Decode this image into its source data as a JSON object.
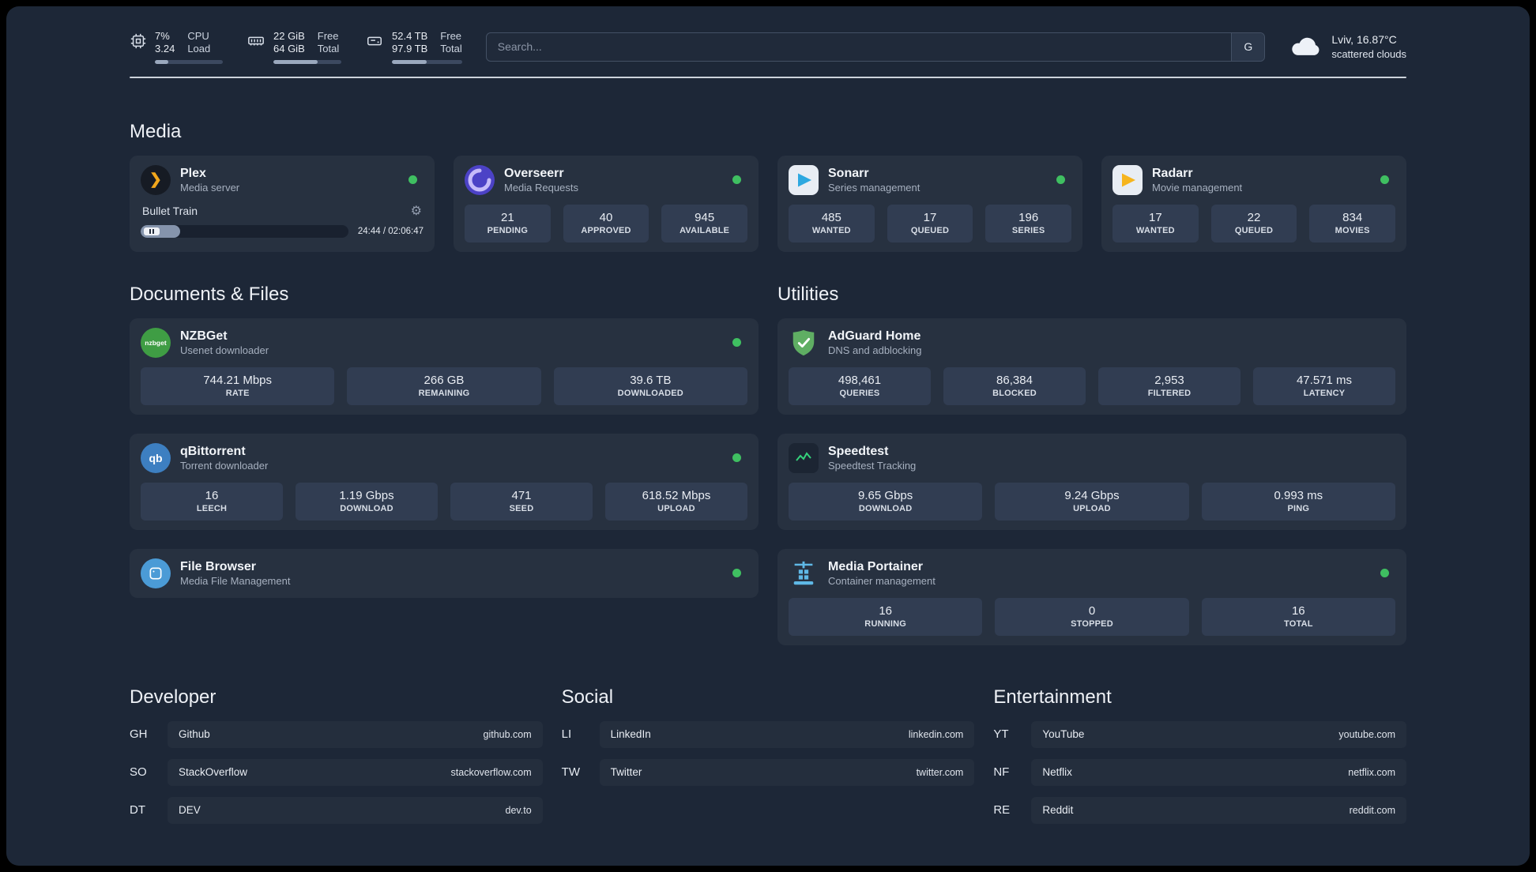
{
  "colors": {
    "status_online": "#3fbf61",
    "page_bg": "#1d2737",
    "card_bg": "#273140",
    "tile_bg": "#313d52"
  },
  "icons": {
    "plex_glyph": "❯",
    "gear_glyph": "⚙",
    "qbittorrent_glyph": "qb",
    "nzbget_glyph": "nzbget"
  },
  "topbar": {
    "cpu": {
      "percent": "7%",
      "load": "3.24",
      "label1": "CPU",
      "label2": "Load",
      "bar": 20
    },
    "memory": {
      "value1": "22 GiB",
      "value2": "64 GiB",
      "label1": "Free",
      "label2": "Total",
      "bar": 65
    },
    "disk": {
      "value1": "52.4 TB",
      "value2": "97.9 TB",
      "label1": "Free",
      "label2": "Total",
      "bar": 50
    },
    "search": {
      "placeholder": "Search...",
      "button": "G"
    },
    "weather": {
      "location": "Lviv, 16.87°C",
      "condition": "scattered clouds"
    }
  },
  "sections": {
    "media": {
      "title": "Media",
      "plex": {
        "name": "Plex",
        "subtitle": "Media server",
        "now_playing": "Bullet Train",
        "time": "24:44 / 02:06:47",
        "progress": 19
      },
      "overseerr": {
        "name": "Overseerr",
        "subtitle": "Media Requests",
        "stats": [
          {
            "value": "21",
            "label": "PENDING"
          },
          {
            "value": "40",
            "label": "APPROVED"
          },
          {
            "value": "945",
            "label": "AVAILABLE"
          }
        ]
      },
      "sonarr": {
        "name": "Sonarr",
        "subtitle": "Series management",
        "stats": [
          {
            "value": "485",
            "label": "WANTED"
          },
          {
            "value": "17",
            "label": "QUEUED"
          },
          {
            "value": "196",
            "label": "SERIES"
          }
        ]
      },
      "radarr": {
        "name": "Radarr",
        "subtitle": "Movie management",
        "stats": [
          {
            "value": "17",
            "label": "WANTED"
          },
          {
            "value": "22",
            "label": "QUEUED"
          },
          {
            "value": "834",
            "label": "MOVIES"
          }
        ]
      }
    },
    "documents": {
      "title": "Documents & Files",
      "nzbget": {
        "name": "NZBGet",
        "subtitle": "Usenet downloader",
        "stats": [
          {
            "value": "744.21 Mbps",
            "label": "RATE"
          },
          {
            "value": "266 GB",
            "label": "REMAINING"
          },
          {
            "value": "39.6 TB",
            "label": "DOWNLOADED"
          }
        ]
      },
      "qbittorrent": {
        "name": "qBittorrent",
        "subtitle": "Torrent downloader",
        "stats": [
          {
            "value": "16",
            "label": "LEECH"
          },
          {
            "value": "1.19 Gbps",
            "label": "DOWNLOAD"
          },
          {
            "value": "471",
            "label": "SEED"
          },
          {
            "value": "618.52 Mbps",
            "label": "UPLOAD"
          }
        ]
      },
      "filebrowser": {
        "name": "File Browser",
        "subtitle": "Media File Management"
      }
    },
    "utilities": {
      "title": "Utilities",
      "adguard": {
        "name": "AdGuard Home",
        "subtitle": "DNS and adblocking",
        "stats": [
          {
            "value": "498,461",
            "label": "QUERIES"
          },
          {
            "value": "86,384",
            "label": "BLOCKED"
          },
          {
            "value": "2,953",
            "label": "FILTERED"
          },
          {
            "value": "47.571 ms",
            "label": "LATENCY"
          }
        ]
      },
      "speedtest": {
        "name": "Speedtest",
        "subtitle": "Speedtest Tracking",
        "stats": [
          {
            "value": "9.65 Gbps",
            "label": "DOWNLOAD"
          },
          {
            "value": "9.24 Gbps",
            "label": "UPLOAD"
          },
          {
            "value": "0.993 ms",
            "label": "PING"
          }
        ]
      },
      "portainer": {
        "name": "Media Portainer",
        "subtitle": "Container management",
        "stats": [
          {
            "value": "16",
            "label": "RUNNING"
          },
          {
            "value": "0",
            "label": "STOPPED"
          },
          {
            "value": "16",
            "label": "TOTAL"
          }
        ]
      }
    },
    "bookmarks": [
      {
        "title": "Developer",
        "items": [
          {
            "abbr": "GH",
            "name": "Github",
            "url": "github.com"
          },
          {
            "abbr": "SO",
            "name": "StackOverflow",
            "url": "stackoverflow.com"
          },
          {
            "abbr": "DT",
            "name": "DEV",
            "url": "dev.to"
          }
        ]
      },
      {
        "title": "Social",
        "items": [
          {
            "abbr": "LI",
            "name": "LinkedIn",
            "url": "linkedin.com"
          },
          {
            "abbr": "TW",
            "name": "Twitter",
            "url": "twitter.com"
          }
        ]
      },
      {
        "title": "Entertainment",
        "items": [
          {
            "abbr": "YT",
            "name": "YouTube",
            "url": "youtube.com"
          },
          {
            "abbr": "NF",
            "name": "Netflix",
            "url": "netflix.com"
          },
          {
            "abbr": "RE",
            "name": "Reddit",
            "url": "reddit.com"
          }
        ]
      }
    ]
  }
}
